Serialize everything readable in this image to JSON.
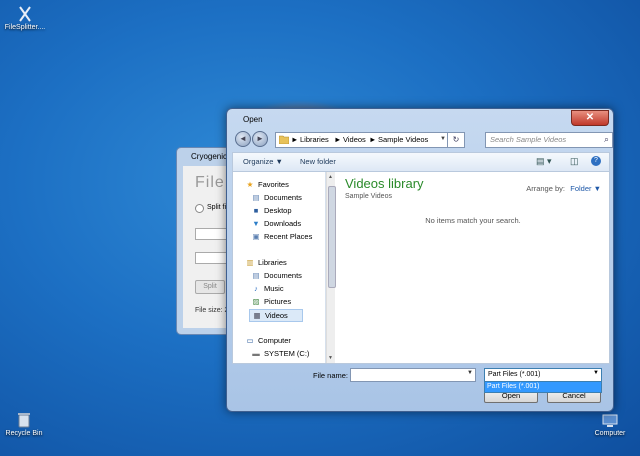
{
  "desktop": {
    "top_icon_label": "FileSplitter....",
    "recycle_label": "Recycle Bin",
    "computer_label": "Computer"
  },
  "background_app": {
    "title": "Cryogenic",
    "heading": "File",
    "radio_label": "Split file",
    "split_button": "Split",
    "file_size_label": "File size: 2"
  },
  "dialog": {
    "title": "Open",
    "close_glyph": "✕",
    "back_glyph": "◄",
    "forward_glyph": "►",
    "address": {
      "crumbs": [
        "Libraries",
        "Videos",
        "Sample Videos"
      ],
      "sep": "►",
      "dropdown_glyph": "▼",
      "refresh_glyph": "↻"
    },
    "search_placeholder": "Search Sample Videos",
    "search_glyph": "⌕",
    "toolbar": {
      "organize": "Organize ▼",
      "new_folder": "New folder",
      "view_glyph": "▤ ▾",
      "pane_glyph": "◫",
      "help_glyph": "?"
    },
    "nav": {
      "favorites": "Favorites",
      "fav_items": [
        "Documents",
        "Desktop",
        "Downloads",
        "Recent Places"
      ],
      "libraries": "Libraries",
      "lib_items": [
        "Documents",
        "Music",
        "Pictures",
        "Videos"
      ],
      "computer": "Computer",
      "drive": "SYSTEM (C:)"
    },
    "content": {
      "library_title": "Videos library",
      "library_sub": "Sample Videos",
      "arrange_label": "Arrange by:",
      "arrange_value": "Folder ▼",
      "empty_text": "No items match your search."
    },
    "footer": {
      "file_name_label": "File name:",
      "file_name_value": "",
      "filter_selected": "Part Files (*.001)",
      "filter_option": "Part Files (*.001)",
      "open_button": "Open",
      "cancel_button": "Cancel"
    }
  }
}
